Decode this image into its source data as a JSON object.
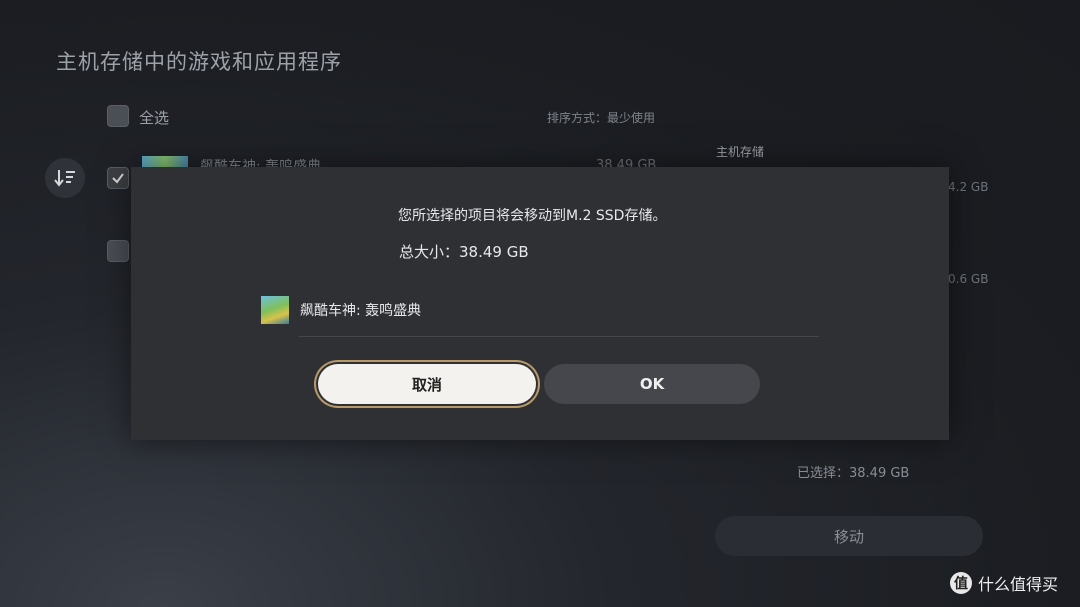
{
  "header": {
    "title": "主机存储中的游戏和应用程序"
  },
  "list": {
    "select_all_label": "全选",
    "sort_label": "排序方式：最少使用",
    "storage_label": "主机存储",
    "rows": [
      {
        "title": "飙酷车神: 轰鸣盛典",
        "size": "38.49 GB",
        "checked": true,
        "side_size": "4.2 GB"
      },
      {
        "title": "",
        "size": "",
        "checked": false,
        "side_size": "0.6 GB"
      }
    ],
    "selected_total": "已选择：38.49 GB",
    "move_label": "移动"
  },
  "dialog": {
    "message": "您所选择的项目将会移动到M.2 SSD存储。",
    "total": "总大小：38.49 GB",
    "item_title": "飙酷车神: 轰鸣盛典",
    "cancel_label": "取消",
    "ok_label": "OK"
  },
  "watermark": {
    "symbol": "值",
    "text": "什么值得买"
  },
  "colors": {
    "focus_ring": "#b89a6a",
    "dialog_bg": "#2f3033"
  }
}
